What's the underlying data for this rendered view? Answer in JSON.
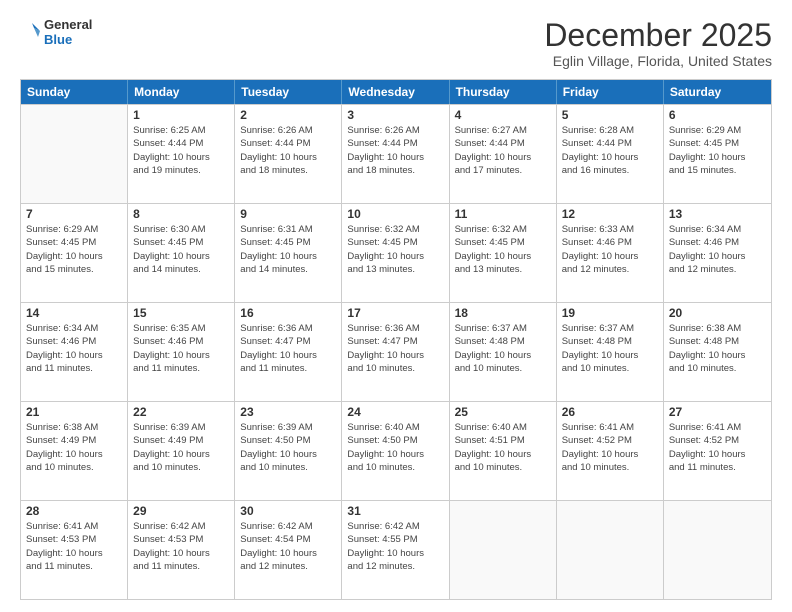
{
  "header": {
    "logo_line1": "General",
    "logo_line2": "Blue",
    "title": "December 2025",
    "subtitle": "Eglin Village, Florida, United States"
  },
  "calendar": {
    "days_of_week": [
      "Sunday",
      "Monday",
      "Tuesday",
      "Wednesday",
      "Thursday",
      "Friday",
      "Saturday"
    ],
    "rows": [
      [
        {
          "day": "",
          "info": ""
        },
        {
          "day": "1",
          "info": "Sunrise: 6:25 AM\nSunset: 4:44 PM\nDaylight: 10 hours\nand 19 minutes."
        },
        {
          "day": "2",
          "info": "Sunrise: 6:26 AM\nSunset: 4:44 PM\nDaylight: 10 hours\nand 18 minutes."
        },
        {
          "day": "3",
          "info": "Sunrise: 6:26 AM\nSunset: 4:44 PM\nDaylight: 10 hours\nand 18 minutes."
        },
        {
          "day": "4",
          "info": "Sunrise: 6:27 AM\nSunset: 4:44 PM\nDaylight: 10 hours\nand 17 minutes."
        },
        {
          "day": "5",
          "info": "Sunrise: 6:28 AM\nSunset: 4:44 PM\nDaylight: 10 hours\nand 16 minutes."
        },
        {
          "day": "6",
          "info": "Sunrise: 6:29 AM\nSunset: 4:45 PM\nDaylight: 10 hours\nand 15 minutes."
        }
      ],
      [
        {
          "day": "7",
          "info": "Sunrise: 6:29 AM\nSunset: 4:45 PM\nDaylight: 10 hours\nand 15 minutes."
        },
        {
          "day": "8",
          "info": "Sunrise: 6:30 AM\nSunset: 4:45 PM\nDaylight: 10 hours\nand 14 minutes."
        },
        {
          "day": "9",
          "info": "Sunrise: 6:31 AM\nSunset: 4:45 PM\nDaylight: 10 hours\nand 14 minutes."
        },
        {
          "day": "10",
          "info": "Sunrise: 6:32 AM\nSunset: 4:45 PM\nDaylight: 10 hours\nand 13 minutes."
        },
        {
          "day": "11",
          "info": "Sunrise: 6:32 AM\nSunset: 4:45 PM\nDaylight: 10 hours\nand 13 minutes."
        },
        {
          "day": "12",
          "info": "Sunrise: 6:33 AM\nSunset: 4:46 PM\nDaylight: 10 hours\nand 12 minutes."
        },
        {
          "day": "13",
          "info": "Sunrise: 6:34 AM\nSunset: 4:46 PM\nDaylight: 10 hours\nand 12 minutes."
        }
      ],
      [
        {
          "day": "14",
          "info": "Sunrise: 6:34 AM\nSunset: 4:46 PM\nDaylight: 10 hours\nand 11 minutes."
        },
        {
          "day": "15",
          "info": "Sunrise: 6:35 AM\nSunset: 4:46 PM\nDaylight: 10 hours\nand 11 minutes."
        },
        {
          "day": "16",
          "info": "Sunrise: 6:36 AM\nSunset: 4:47 PM\nDaylight: 10 hours\nand 11 minutes."
        },
        {
          "day": "17",
          "info": "Sunrise: 6:36 AM\nSunset: 4:47 PM\nDaylight: 10 hours\nand 10 minutes."
        },
        {
          "day": "18",
          "info": "Sunrise: 6:37 AM\nSunset: 4:48 PM\nDaylight: 10 hours\nand 10 minutes."
        },
        {
          "day": "19",
          "info": "Sunrise: 6:37 AM\nSunset: 4:48 PM\nDaylight: 10 hours\nand 10 minutes."
        },
        {
          "day": "20",
          "info": "Sunrise: 6:38 AM\nSunset: 4:48 PM\nDaylight: 10 hours\nand 10 minutes."
        }
      ],
      [
        {
          "day": "21",
          "info": "Sunrise: 6:38 AM\nSunset: 4:49 PM\nDaylight: 10 hours\nand 10 minutes."
        },
        {
          "day": "22",
          "info": "Sunrise: 6:39 AM\nSunset: 4:49 PM\nDaylight: 10 hours\nand 10 minutes."
        },
        {
          "day": "23",
          "info": "Sunrise: 6:39 AM\nSunset: 4:50 PM\nDaylight: 10 hours\nand 10 minutes."
        },
        {
          "day": "24",
          "info": "Sunrise: 6:40 AM\nSunset: 4:50 PM\nDaylight: 10 hours\nand 10 minutes."
        },
        {
          "day": "25",
          "info": "Sunrise: 6:40 AM\nSunset: 4:51 PM\nDaylight: 10 hours\nand 10 minutes."
        },
        {
          "day": "26",
          "info": "Sunrise: 6:41 AM\nSunset: 4:52 PM\nDaylight: 10 hours\nand 10 minutes."
        },
        {
          "day": "27",
          "info": "Sunrise: 6:41 AM\nSunset: 4:52 PM\nDaylight: 10 hours\nand 11 minutes."
        }
      ],
      [
        {
          "day": "28",
          "info": "Sunrise: 6:41 AM\nSunset: 4:53 PM\nDaylight: 10 hours\nand 11 minutes."
        },
        {
          "day": "29",
          "info": "Sunrise: 6:42 AM\nSunset: 4:53 PM\nDaylight: 10 hours\nand 11 minutes."
        },
        {
          "day": "30",
          "info": "Sunrise: 6:42 AM\nSunset: 4:54 PM\nDaylight: 10 hours\nand 12 minutes."
        },
        {
          "day": "31",
          "info": "Sunrise: 6:42 AM\nSunset: 4:55 PM\nDaylight: 10 hours\nand 12 minutes."
        },
        {
          "day": "",
          "info": ""
        },
        {
          "day": "",
          "info": ""
        },
        {
          "day": "",
          "info": ""
        }
      ]
    ]
  }
}
